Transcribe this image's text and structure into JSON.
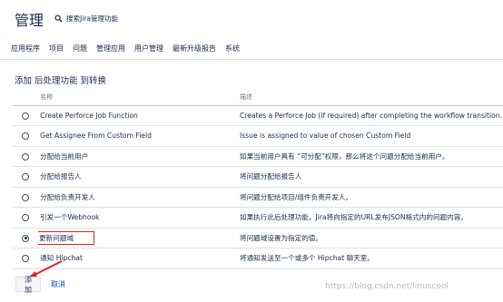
{
  "header": {
    "title": "管理",
    "search_label": "搜索Jira管理功能"
  },
  "nav": {
    "items": [
      "应用程序",
      "项目",
      "问题",
      "管理应用",
      "用户管理",
      "最新升级报告",
      "系统"
    ]
  },
  "section": {
    "title": "添加 后处理功能 到转换"
  },
  "table": {
    "headers": {
      "name": "名称",
      "description": "描述"
    },
    "rows": [
      {
        "name": "Create Perforce Job Function",
        "description": "Creates a Perforce Job (if required) after completing the workflow transition.",
        "selected": false
      },
      {
        "name": "Get Assignee From Custom Field",
        "description": "Issue is assigned to value of chosen Custom Field",
        "selected": false
      },
      {
        "name": "分配给当前用户",
        "description": "如果当前用户具有 “可分配”权限，那么将这个问题分配给当前用户。",
        "selected": false
      },
      {
        "name": "分配给报告人",
        "description": "将问题分配给报告人",
        "selected": false
      },
      {
        "name": "分配给负责开发人",
        "description": "将问题分配给项目/组件负责开发人。",
        "selected": false
      },
      {
        "name": "引发一个Webhook",
        "description": "如果执行此后处理功能，Jira将向指定的URL发布JSON格式内的问题内容。",
        "selected": false
      },
      {
        "name": "更新问题域",
        "description": "将问题域设置为指定的值。",
        "selected": true
      },
      {
        "name": "通知 Hipchat",
        "description": "将通知发送至一个或多个 Hipchat 聊天室。",
        "selected": false
      }
    ]
  },
  "actions": {
    "add_label": "添加",
    "cancel_label": "取消"
  },
  "watermark": "https://blog.csdn.net/linuscool",
  "colors": {
    "highlight": "#e02020",
    "link": "#0052cc"
  }
}
